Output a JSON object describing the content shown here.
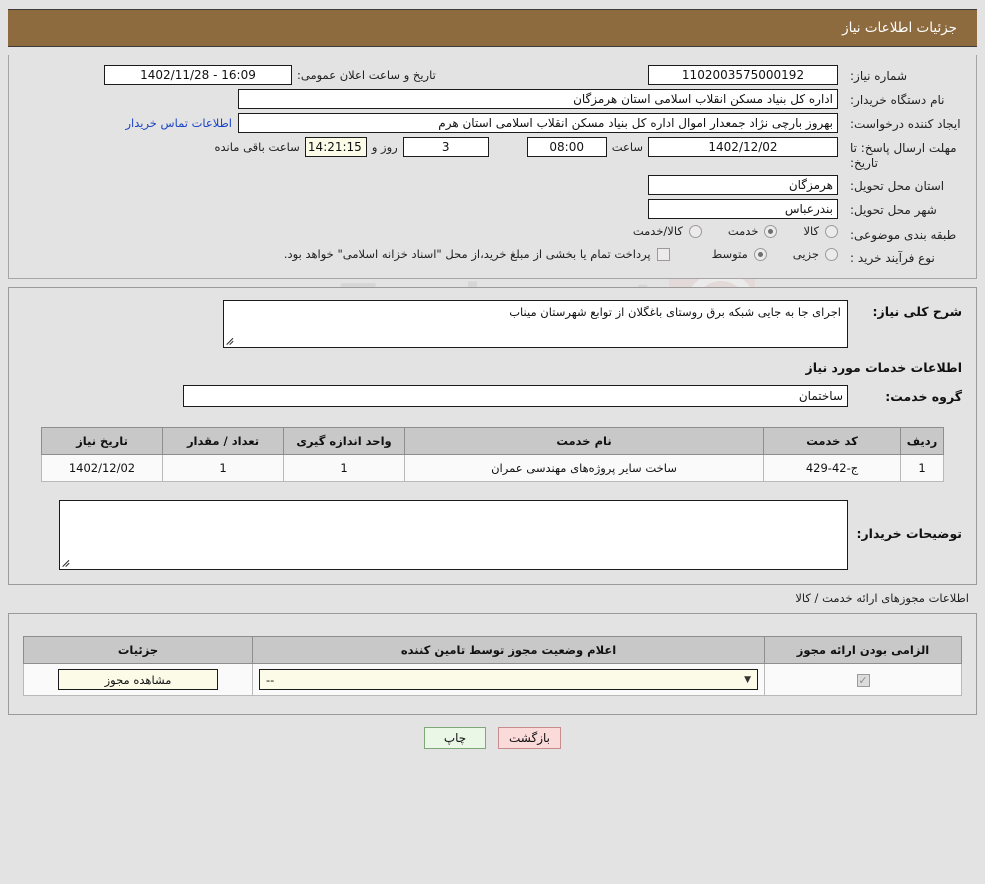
{
  "header": {
    "title": "جزئیات اطلاعات نیاز"
  },
  "top_form": {
    "need_number": {
      "label": "شماره نیاز:",
      "value": "1102003575000192"
    },
    "announce_datetime": {
      "label": "تاریخ و ساعت اعلان عمومی:",
      "value": "16:09 - 1402/11/28"
    },
    "buyer_org": {
      "label": "نام دستگاه خریدار:",
      "value": "اداره کل بنیاد مسکن انقلاب اسلامی استان هرمزگان"
    },
    "requester": {
      "label": "ایجاد کننده درخواست:",
      "value": "بهروز  بارچی نژاد جمعدار اموال اداره کل بنیاد مسکن انقلاب اسلامی استان هرم",
      "contact_link": "اطلاعات تماس خریدار"
    },
    "deadline": {
      "label": "مهلت ارسال پاسخ: تا تاریخ:",
      "date": "1402/12/02",
      "time_label": "ساعت",
      "time": "08:00",
      "days": "3",
      "days_label": "روز و",
      "countdown": "14:21:15",
      "countdown_suffix": "ساعت باقی مانده"
    },
    "province": {
      "label": "استان محل تحویل:",
      "value": "هرمزگان"
    },
    "city": {
      "label": "شهر محل تحویل:",
      "value": "بندرعباس"
    },
    "category": {
      "label": "طبقه بندی موضوعی:",
      "options": [
        "کالا",
        "خدمت",
        "کالا/خدمت"
      ],
      "selected": "خدمت"
    },
    "purchase_process": {
      "label": "نوع فرآیند خرید :",
      "options": [
        "جزیی",
        "متوسط"
      ],
      "selected": "متوسط",
      "treasury_checkbox_label": "پرداخت تمام یا بخشی از مبلغ خرید،از محل \"اسناد خزانه اسلامی\" خواهد بود.",
      "treasury_checked": false
    }
  },
  "details": {
    "general_description": {
      "label": "شرح کلی نیاز:",
      "value": "اجرای  جا به جایی شبکه برق روستای باغگلان از توابع شهرستان میناب"
    },
    "services_section_title": "اطلاعات خدمات مورد نیاز",
    "service_group": {
      "label": "گروه خدمت:",
      "value": "ساختمان"
    },
    "services_table": {
      "columns": [
        "ردیف",
        "کد خدمت",
        "نام خدمت",
        "واحد اندازه گیری",
        "تعداد / مقدار",
        "تاریخ نیاز"
      ],
      "rows": [
        [
          "1",
          "ج-42-429",
          "ساخت سایر پروژه‌های مهندسی عمران",
          "1",
          "1",
          "1402/12/02"
        ]
      ]
    },
    "buyer_notes": {
      "label": "توضیحات خریدار:",
      "value": ""
    }
  },
  "permits": {
    "section_title": "اطلاعات مجوزهای ارائه خدمت / کالا",
    "columns": [
      "الزامی بودن ارائه مجوز",
      "اعلام وضعیت مجوز توسط تامین کننده",
      "جزئیات"
    ],
    "rows": [
      {
        "required_checked": true,
        "status_value": "--",
        "detail_button": "مشاهده مجوز"
      }
    ]
  },
  "footer": {
    "print_label": "چاپ",
    "back_label": "بازگشت"
  },
  "watermark": {
    "text": "anaTender.net"
  },
  "colors": {
    "titlebar": "#8e6b3e",
    "page_bg": "#e3e3e3",
    "link": "#1c44c6",
    "table_header": "#c8c8c8",
    "cream": "#fbfbe8",
    "print_btn": "#eaf6e6",
    "back_btn": "#fbdada"
  }
}
